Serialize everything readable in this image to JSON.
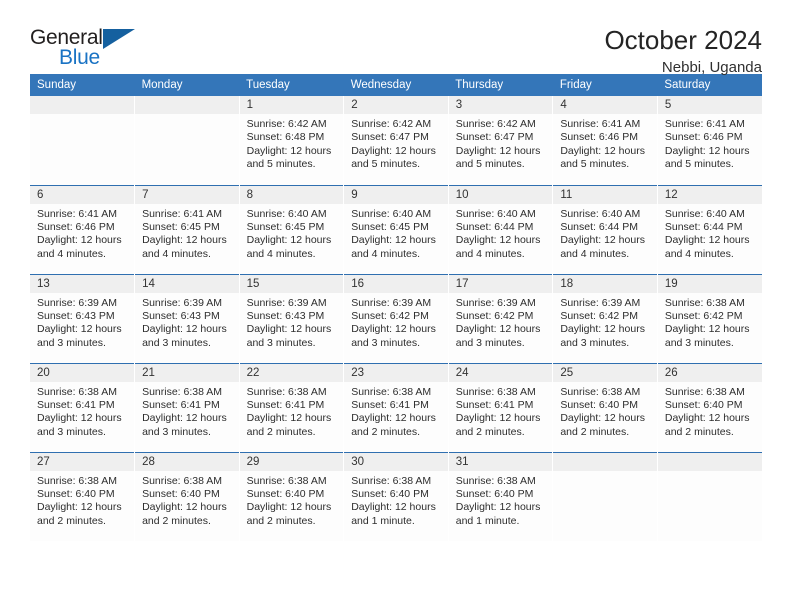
{
  "logo": {
    "word_one": "General",
    "word_two": "Blue",
    "triangle_color": "#15609f",
    "blue_color": "#1a73c4"
  },
  "header": {
    "title": "October 2024",
    "subtitle": "Nebbi, Uganda"
  },
  "theme": {
    "header_band": "#3476b9",
    "daynum_strip": "#efefef",
    "row_divider": "#2f6fb0"
  },
  "weekdays": [
    "Sunday",
    "Monday",
    "Tuesday",
    "Wednesday",
    "Thursday",
    "Friday",
    "Saturday"
  ],
  "weeks": [
    [
      {
        "day": "",
        "sunrise": "",
        "sunset": "",
        "daylight": ""
      },
      {
        "day": "",
        "sunrise": "",
        "sunset": "",
        "daylight": ""
      },
      {
        "day": "1",
        "sunrise": "Sunrise: 6:42 AM",
        "sunset": "Sunset: 6:48 PM",
        "daylight": "Daylight: 12 hours and 5 minutes."
      },
      {
        "day": "2",
        "sunrise": "Sunrise: 6:42 AM",
        "sunset": "Sunset: 6:47 PM",
        "daylight": "Daylight: 12 hours and 5 minutes."
      },
      {
        "day": "3",
        "sunrise": "Sunrise: 6:42 AM",
        "sunset": "Sunset: 6:47 PM",
        "daylight": "Daylight: 12 hours and 5 minutes."
      },
      {
        "day": "4",
        "sunrise": "Sunrise: 6:41 AM",
        "sunset": "Sunset: 6:46 PM",
        "daylight": "Daylight: 12 hours and 5 minutes."
      },
      {
        "day": "5",
        "sunrise": "Sunrise: 6:41 AM",
        "sunset": "Sunset: 6:46 PM",
        "daylight": "Daylight: 12 hours and 5 minutes."
      }
    ],
    [
      {
        "day": "6",
        "sunrise": "Sunrise: 6:41 AM",
        "sunset": "Sunset: 6:46 PM",
        "daylight": "Daylight: 12 hours and 4 minutes."
      },
      {
        "day": "7",
        "sunrise": "Sunrise: 6:41 AM",
        "sunset": "Sunset: 6:45 PM",
        "daylight": "Daylight: 12 hours and 4 minutes."
      },
      {
        "day": "8",
        "sunrise": "Sunrise: 6:40 AM",
        "sunset": "Sunset: 6:45 PM",
        "daylight": "Daylight: 12 hours and 4 minutes."
      },
      {
        "day": "9",
        "sunrise": "Sunrise: 6:40 AM",
        "sunset": "Sunset: 6:45 PM",
        "daylight": "Daylight: 12 hours and 4 minutes."
      },
      {
        "day": "10",
        "sunrise": "Sunrise: 6:40 AM",
        "sunset": "Sunset: 6:44 PM",
        "daylight": "Daylight: 12 hours and 4 minutes."
      },
      {
        "day": "11",
        "sunrise": "Sunrise: 6:40 AM",
        "sunset": "Sunset: 6:44 PM",
        "daylight": "Daylight: 12 hours and 4 minutes."
      },
      {
        "day": "12",
        "sunrise": "Sunrise: 6:40 AM",
        "sunset": "Sunset: 6:44 PM",
        "daylight": "Daylight: 12 hours and 4 minutes."
      }
    ],
    [
      {
        "day": "13",
        "sunrise": "Sunrise: 6:39 AM",
        "sunset": "Sunset: 6:43 PM",
        "daylight": "Daylight: 12 hours and 3 minutes."
      },
      {
        "day": "14",
        "sunrise": "Sunrise: 6:39 AM",
        "sunset": "Sunset: 6:43 PM",
        "daylight": "Daylight: 12 hours and 3 minutes."
      },
      {
        "day": "15",
        "sunrise": "Sunrise: 6:39 AM",
        "sunset": "Sunset: 6:43 PM",
        "daylight": "Daylight: 12 hours and 3 minutes."
      },
      {
        "day": "16",
        "sunrise": "Sunrise: 6:39 AM",
        "sunset": "Sunset: 6:42 PM",
        "daylight": "Daylight: 12 hours and 3 minutes."
      },
      {
        "day": "17",
        "sunrise": "Sunrise: 6:39 AM",
        "sunset": "Sunset: 6:42 PM",
        "daylight": "Daylight: 12 hours and 3 minutes."
      },
      {
        "day": "18",
        "sunrise": "Sunrise: 6:39 AM",
        "sunset": "Sunset: 6:42 PM",
        "daylight": "Daylight: 12 hours and 3 minutes."
      },
      {
        "day": "19",
        "sunrise": "Sunrise: 6:38 AM",
        "sunset": "Sunset: 6:42 PM",
        "daylight": "Daylight: 12 hours and 3 minutes."
      }
    ],
    [
      {
        "day": "20",
        "sunrise": "Sunrise: 6:38 AM",
        "sunset": "Sunset: 6:41 PM",
        "daylight": "Daylight: 12 hours and 3 minutes."
      },
      {
        "day": "21",
        "sunrise": "Sunrise: 6:38 AM",
        "sunset": "Sunset: 6:41 PM",
        "daylight": "Daylight: 12 hours and 3 minutes."
      },
      {
        "day": "22",
        "sunrise": "Sunrise: 6:38 AM",
        "sunset": "Sunset: 6:41 PM",
        "daylight": "Daylight: 12 hours and 2 minutes."
      },
      {
        "day": "23",
        "sunrise": "Sunrise: 6:38 AM",
        "sunset": "Sunset: 6:41 PM",
        "daylight": "Daylight: 12 hours and 2 minutes."
      },
      {
        "day": "24",
        "sunrise": "Sunrise: 6:38 AM",
        "sunset": "Sunset: 6:41 PM",
        "daylight": "Daylight: 12 hours and 2 minutes."
      },
      {
        "day": "25",
        "sunrise": "Sunrise: 6:38 AM",
        "sunset": "Sunset: 6:40 PM",
        "daylight": "Daylight: 12 hours and 2 minutes."
      },
      {
        "day": "26",
        "sunrise": "Sunrise: 6:38 AM",
        "sunset": "Sunset: 6:40 PM",
        "daylight": "Daylight: 12 hours and 2 minutes."
      }
    ],
    [
      {
        "day": "27",
        "sunrise": "Sunrise: 6:38 AM",
        "sunset": "Sunset: 6:40 PM",
        "daylight": "Daylight: 12 hours and 2 minutes."
      },
      {
        "day": "28",
        "sunrise": "Sunrise: 6:38 AM",
        "sunset": "Sunset: 6:40 PM",
        "daylight": "Daylight: 12 hours and 2 minutes."
      },
      {
        "day": "29",
        "sunrise": "Sunrise: 6:38 AM",
        "sunset": "Sunset: 6:40 PM",
        "daylight": "Daylight: 12 hours and 2 minutes."
      },
      {
        "day": "30",
        "sunrise": "Sunrise: 6:38 AM",
        "sunset": "Sunset: 6:40 PM",
        "daylight": "Daylight: 12 hours and 1 minute."
      },
      {
        "day": "31",
        "sunrise": "Sunrise: 6:38 AM",
        "sunset": "Sunset: 6:40 PM",
        "daylight": "Daylight: 12 hours and 1 minute."
      },
      {
        "day": "",
        "sunrise": "",
        "sunset": "",
        "daylight": ""
      },
      {
        "day": "",
        "sunrise": "",
        "sunset": "",
        "daylight": ""
      }
    ]
  ]
}
